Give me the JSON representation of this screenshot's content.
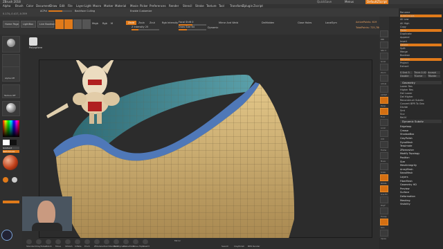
{
  "title_bar": {
    "app_title": "ZBrush 2018",
    "center_text": "QuickSave",
    "center_right": "Menus",
    "right_label": "DefaultZScript"
  },
  "menu": {
    "items": [
      "Alpha",
      "Brush",
      "Color",
      "Document",
      "Draw",
      "Edit",
      "File",
      "Layer",
      "Light",
      "Macro",
      "Marker",
      "Material",
      "Movie",
      "Picker",
      "Preferences",
      "Render",
      "Stencil",
      "Stroke",
      "Texture",
      "Tool",
      "Transform",
      "Zplugin",
      "Zscript"
    ],
    "see_through": "See-through 0",
    "quick_save": "QuickSave",
    "default": "DefaultZScript"
  },
  "tool_row": {
    "coords": "0.174,-0.417,-0.359",
    "ac_pct": "ACPct",
    "backface": "Backface Culling",
    "enable_customize": "Enable Customize"
  },
  "shelf": {
    "home_page": "Home Page",
    "lightbox": "LightBox",
    "live_boolean": "Live Boolean",
    "edit": "Edit",
    "draw": "Draw",
    "move": "Move",
    "scale": "Scale",
    "rotate": "Rotate",
    "mrgb": "Mrgb",
    "rgb": "Rgb",
    "m": "M",
    "zadd": "Zadd",
    "zsub": "Zsub",
    "zcut": "Zcut",
    "rgb_intensity": "Rgb Intensity",
    "z_intensity": "Z Intensity 25",
    "focal_shift": "Focal Shift 0",
    "draw_size": "Draw Size 64",
    "dynamic": "Dynamic",
    "mirror_weld": "Mirror And Weld",
    "delhidden": "DelHidden",
    "closeholes": "Close Holes",
    "localsym": "LocalSym",
    "active_points": "ActivePoints: 619",
    "total_points": "TotalPoints: 725,780"
  },
  "left_tray": {
    "material": "Skin",
    "alpha_off": "Alpha Off",
    "texture_off": "Texture Off",
    "mat_name": "MatCap Red",
    "gradient": "Gradient",
    "switch_color": "SwitchColor",
    "alternate": "Alternate"
  },
  "canvas": {
    "tool_name": "Polysphere"
  },
  "right_icons": [
    "BPR",
    "SPix 3",
    "Scroll",
    "Zoom",
    "Actual",
    "AAHalf",
    "Persp",
    "Floor",
    "Local",
    "XYZ",
    "Frame",
    "Move",
    "Scale",
    "Rotate",
    "Line Fill",
    "PolyF",
    "Transp",
    "Solo",
    "Xpose"
  ],
  "right_icons_on": [
    6,
    7,
    13,
    14,
    17
  ],
  "panel": {
    "top_items": [
      "Rename",
      "AutoGroups",
      "All Low",
      "All High",
      "Copy",
      "Paste",
      "Duplicate",
      "Append",
      "Insert",
      "Delete",
      "Split",
      "Merge",
      "Boolean",
      "Remesh",
      "Project",
      "Extract"
    ],
    "top_right": [
      "Rename",
      "All Low",
      "All High",
      "Split",
      "Append",
      "Insert",
      "Del Other",
      "Del All"
    ],
    "subtool_labels": [
      "Split",
      "Merge",
      "Boolean",
      "Remesh",
      "Project",
      "Extract"
    ],
    "extract_options": [
      "S Smt 5",
      "Thick 0.02",
      "Accept",
      "Double",
      "TCorne",
      "TBorde"
    ],
    "geometry_header": "Geometry",
    "geometry_items": [
      "Lower Res",
      "Higher Res",
      "Del Lower",
      "Del Higher",
      "Reconstruct Subdiv",
      "Convert BPR To Geo",
      "Divide",
      "Smt",
      "Suv",
      "ReUV"
    ],
    "dynamesh_header": "Dynamic Subdiv",
    "sections": [
      "Edgeloop",
      "Crease",
      "ShadowBox",
      "ClayPolish",
      "DynaMesh",
      "Tessimate",
      "ZRemesher",
      "Modify Topology",
      "Position",
      "Size",
      "MeshIntegrity",
      "ArrayMesh",
      "NanoMesh",
      "Layers",
      "FiberMesh",
      "Geometry HD",
      "Preview",
      "Surface",
      "Deformation",
      "Masking",
      "Visibility"
    ]
  },
  "bottom_bar": {
    "items": [
      "Standard",
      "ClayTubes",
      "Polish",
      "Move",
      "hPolish",
      "Inflate",
      "Pinch",
      "ZModeler",
      "DamStandard",
      "TrimDynamic",
      "CurveTube",
      "Move Topo",
      "Slash3"
    ],
    "mirror_label": "Mirror",
    "search": "Search",
    "claypolish": "ClayPolish",
    "bpr_render": "BPR Render"
  },
  "colors": {
    "accent": "#e07a1a",
    "model_yellow": "#d9b878",
    "model_blue": "#4f78b8",
    "teal_inner": "#3f7f8a"
  }
}
